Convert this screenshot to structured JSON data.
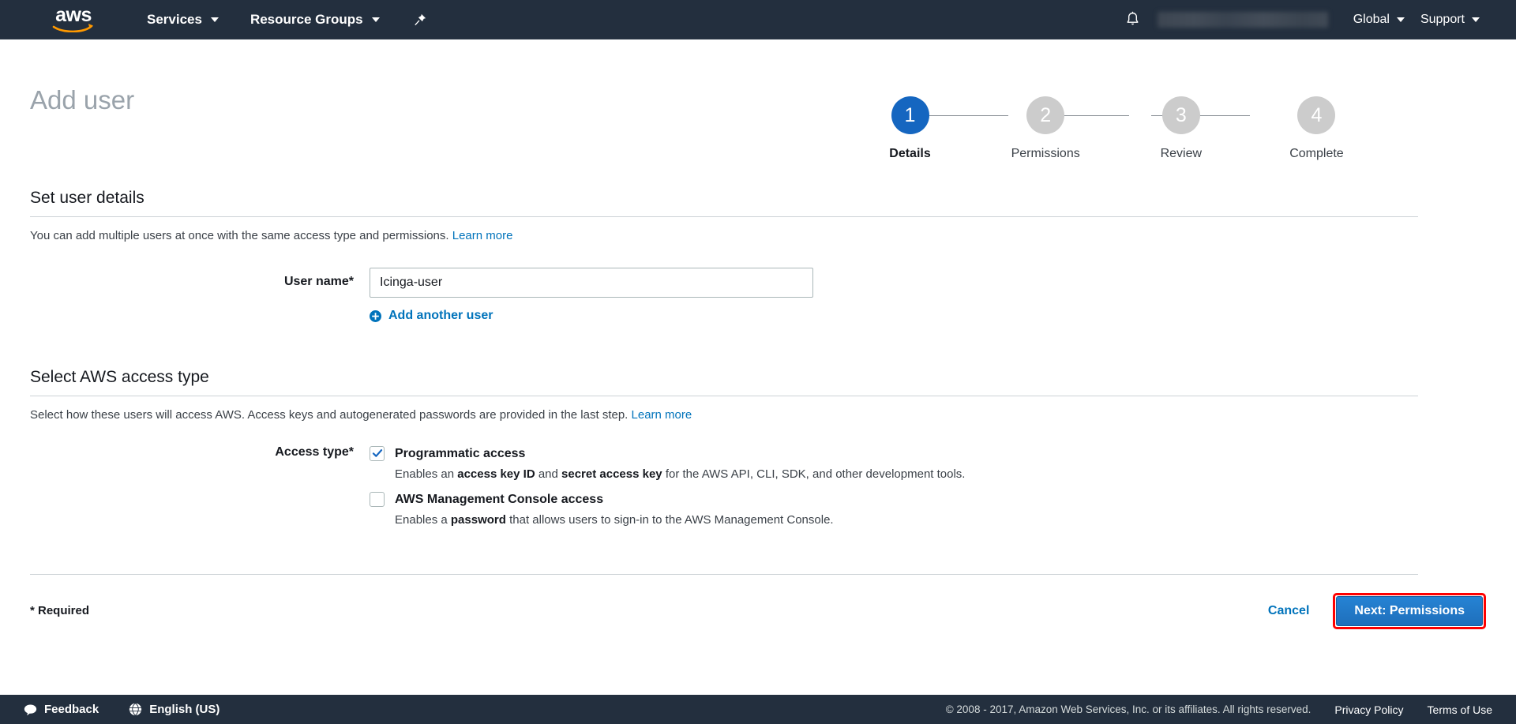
{
  "nav": {
    "logo_text": "aws",
    "logo_name": "aws-logo",
    "services_label": "Services",
    "resource_groups_label": "Resource Groups",
    "pin_icon": "pushpin-icon",
    "bell_icon": "notifications-bell-icon",
    "account_label": "",
    "global_label": "Global",
    "support_label": "Support"
  },
  "page": {
    "title": "Add user"
  },
  "wizard": {
    "steps": [
      {
        "number": "1",
        "label": "Details"
      },
      {
        "number": "2",
        "label": "Permissions"
      },
      {
        "number": "3",
        "label": "Review"
      },
      {
        "number": "4",
        "label": "Complete"
      }
    ],
    "active_index": 0,
    "active_color": "#1566c0",
    "inactive_color": "#cccccc"
  },
  "user_details": {
    "section_title": "Set user details",
    "description": "You can add multiple users at once with the same access type and permissions.",
    "learn_more": "Learn more",
    "user_name_label": "User name*",
    "user_name_value": "Icinga-user",
    "user_name_placeholder": "",
    "add_another_label": "Add another user",
    "add_another_icon": "plus-circle-icon"
  },
  "access_type": {
    "section_title": "Select AWS access type",
    "description": "Select how these users will access AWS. Access keys and autogenerated passwords are provided in the last step.",
    "learn_more": "Learn more",
    "label": "Access type*",
    "options": [
      {
        "title": "Programmatic access",
        "checked": true,
        "desc_prefix": "Enables an ",
        "desc_bold1": "access key ID",
        "desc_mid": " and ",
        "desc_bold2": "secret access key",
        "desc_suffix": " for the AWS API, CLI, SDK, and other development tools."
      },
      {
        "title": "AWS Management Console access",
        "checked": false,
        "desc_prefix": "Enables a ",
        "desc_bold1": "password",
        "desc_mid": "",
        "desc_bold2": "",
        "desc_suffix": " that allows users to sign-in to the AWS Management Console."
      }
    ]
  },
  "actions": {
    "required_note": "* Required",
    "cancel_label": "Cancel",
    "next_label": "Next: Permissions",
    "next_highlight_color": "#ff0000",
    "next_button_color": "#2583d4"
  },
  "footer": {
    "feedback_label": "Feedback",
    "feedback_icon": "speech-bubble-icon",
    "language_label": "English (US)",
    "language_icon": "globe-icon",
    "copyright": "© 2008 - 2017, Amazon Web Services, Inc. or its affiliates. All rights reserved.",
    "privacy_label": "Privacy Policy",
    "terms_label": "Terms of Use"
  }
}
